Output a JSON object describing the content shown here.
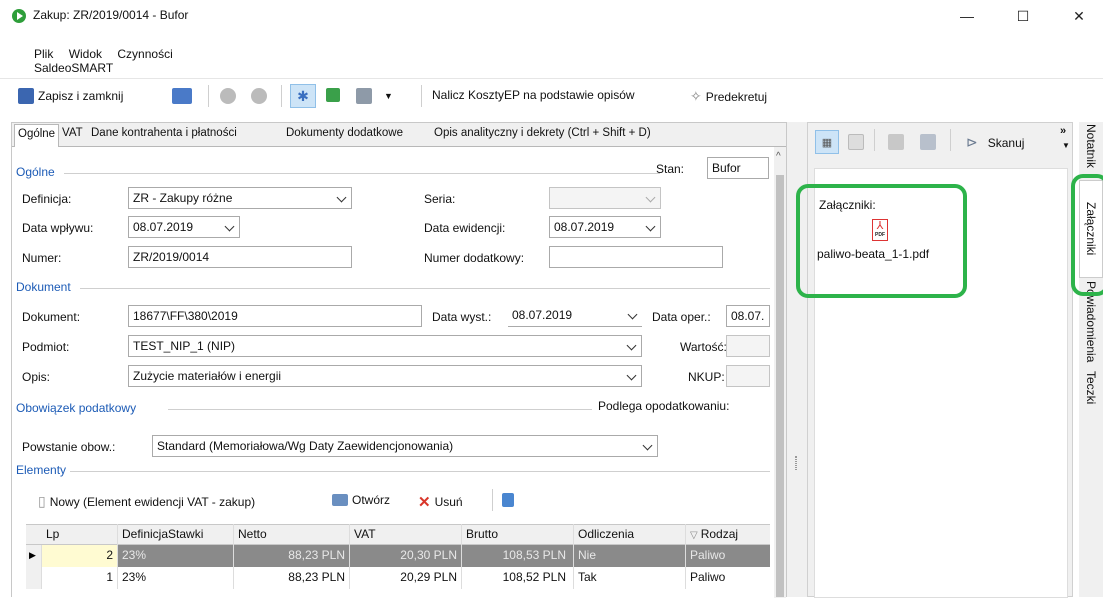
{
  "window": {
    "title": "Zakup: ZR/2019/0014 - Bufor",
    "minimize": "—",
    "maximize": "☐",
    "close": "✕"
  },
  "menu": [
    "Plik",
    "Widok",
    "Czynności",
    "SaldeoSMART"
  ],
  "toolbar": {
    "save_close": "Zapisz i zamknij",
    "nalicz": "Nalicz KosztyEP na podstawie opisów",
    "predekretuj": "Predekretuj"
  },
  "tabs": [
    "Ogólne",
    "VAT",
    "Dane kontrahenta i płatności",
    "Dokumenty dodatkowe",
    "Opis analityczny i dekrety (Ctrl + Shift + D)"
  ],
  "ogolne": {
    "section": "Ogólne",
    "stan_label": "Stan:",
    "stan": "Bufor",
    "definicja_label": "Definicja:",
    "definicja": "ZR - Zakupy różne",
    "seria_label": "Seria:",
    "seria": "",
    "data_wplywu_label": "Data wpływu:",
    "data_wplywu": "08.07.2019",
    "data_ewid_label": "Data ewidencji:",
    "data_ewid": "08.07.2019",
    "numer_label": "Numer:",
    "numer": "ZR/2019/0014",
    "numer_dod_label": "Numer dodatkowy:",
    "numer_dod": ""
  },
  "dokument": {
    "section": "Dokument",
    "dok_label": "Dokument:",
    "dok": "18677\\FF\\380\\2019",
    "data_wyst_label": "Data wyst.:",
    "data_wyst": "08.07.2019",
    "data_oper_label": "Data oper.:",
    "data_oper": "08.07.",
    "podmiot_label": "Podmiot:",
    "podmiot": "TEST_NIP_1 (NIP)",
    "wartosc_label": "Wartość:",
    "opis_label": "Opis:",
    "opis": "Zużycie materiałów i energii",
    "nkup_label": "NKUP:"
  },
  "podatek": {
    "section": "Obowiązek podatkowy",
    "podlega": "Podlega opodatkowaniu:",
    "powstanie_label": "Powstanie obow.:",
    "powstanie": "Standard (Memoriałowa/Wg Daty Zaewidencjonowania)"
  },
  "elementy": {
    "section": "Elementy",
    "nowy": "Nowy (Element ewidencji VAT - zakup)",
    "otworz": "Otwórz",
    "usun": "Usuń",
    "columns": [
      "Lp",
      "DefinicjaStawki",
      "Netto",
      "VAT",
      "Brutto",
      "Odliczenia",
      "Rodzaj"
    ],
    "rows": [
      {
        "lp": "2",
        "stawka": "23%",
        "netto": "88,23 PLN",
        "vat": "20,30 PLN",
        "brutto": "108,53 PLN",
        "odl": "Nie",
        "rodzaj": "Paliwo"
      },
      {
        "lp": "1",
        "stawka": "23%",
        "netto": "88,23 PLN",
        "vat": "20,29 PLN",
        "brutto": "108,52 PLN",
        "odl": "Tak",
        "rodzaj": "Paliwo"
      }
    ]
  },
  "right": {
    "skanuj": "Skanuj",
    "zalaczniki": "Załączniki:",
    "file": "paliwo-beata_1-1.pdf",
    "pdf_badge": "PDF"
  },
  "vtabs": [
    "Notatnik",
    "Załączniki",
    "Powiadomienia",
    "Teczki"
  ],
  "colors": {
    "accent": "#1c5bb6",
    "highlight": "#2db34a"
  }
}
